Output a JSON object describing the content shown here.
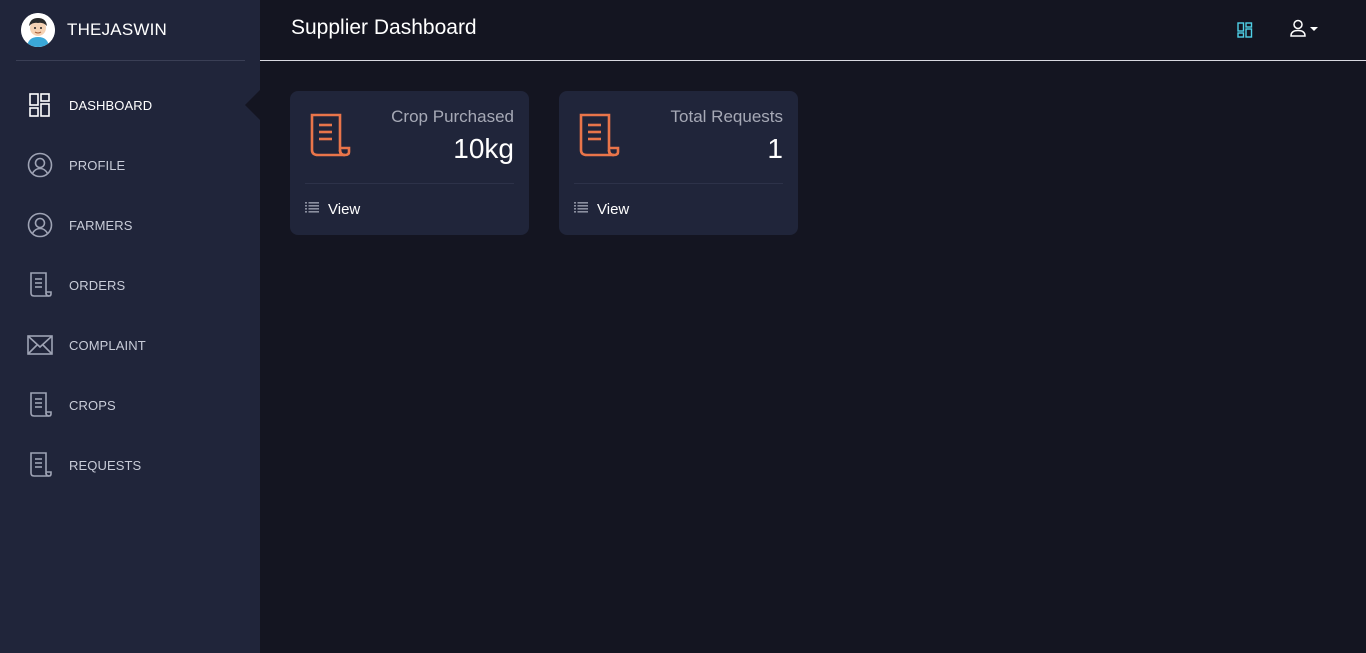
{
  "brand": {
    "name": "THEJASWIN",
    "avatar_icon": "user-avatar"
  },
  "sidebar": {
    "items": [
      {
        "label": "DASHBOARD",
        "icon": "dashboard-icon",
        "active": true
      },
      {
        "label": "PROFILE",
        "icon": "user-circle-icon"
      },
      {
        "label": "FARMERS",
        "icon": "user-circle-icon"
      },
      {
        "label": "ORDERS",
        "icon": "receipt-icon"
      },
      {
        "label": "COMPLAINT",
        "icon": "mail-icon"
      },
      {
        "label": "CROPS",
        "icon": "receipt-icon"
      },
      {
        "label": "REQUESTS",
        "icon": "receipt-icon"
      }
    ]
  },
  "header": {
    "title": "Supplier Dashboard"
  },
  "cards": [
    {
      "label": "Crop Purchased",
      "value": "10kg",
      "link": "View",
      "icon": "receipt-icon"
    },
    {
      "label": "Total Requests",
      "value": "1",
      "link": "View",
      "icon": "receipt-icon"
    }
  ],
  "colors": {
    "background": "#141521",
    "sidebar": "#20253a",
    "card": "#20253a",
    "accent_orange": "#e9754a",
    "header_icon_blue": "#4fd1e8"
  }
}
